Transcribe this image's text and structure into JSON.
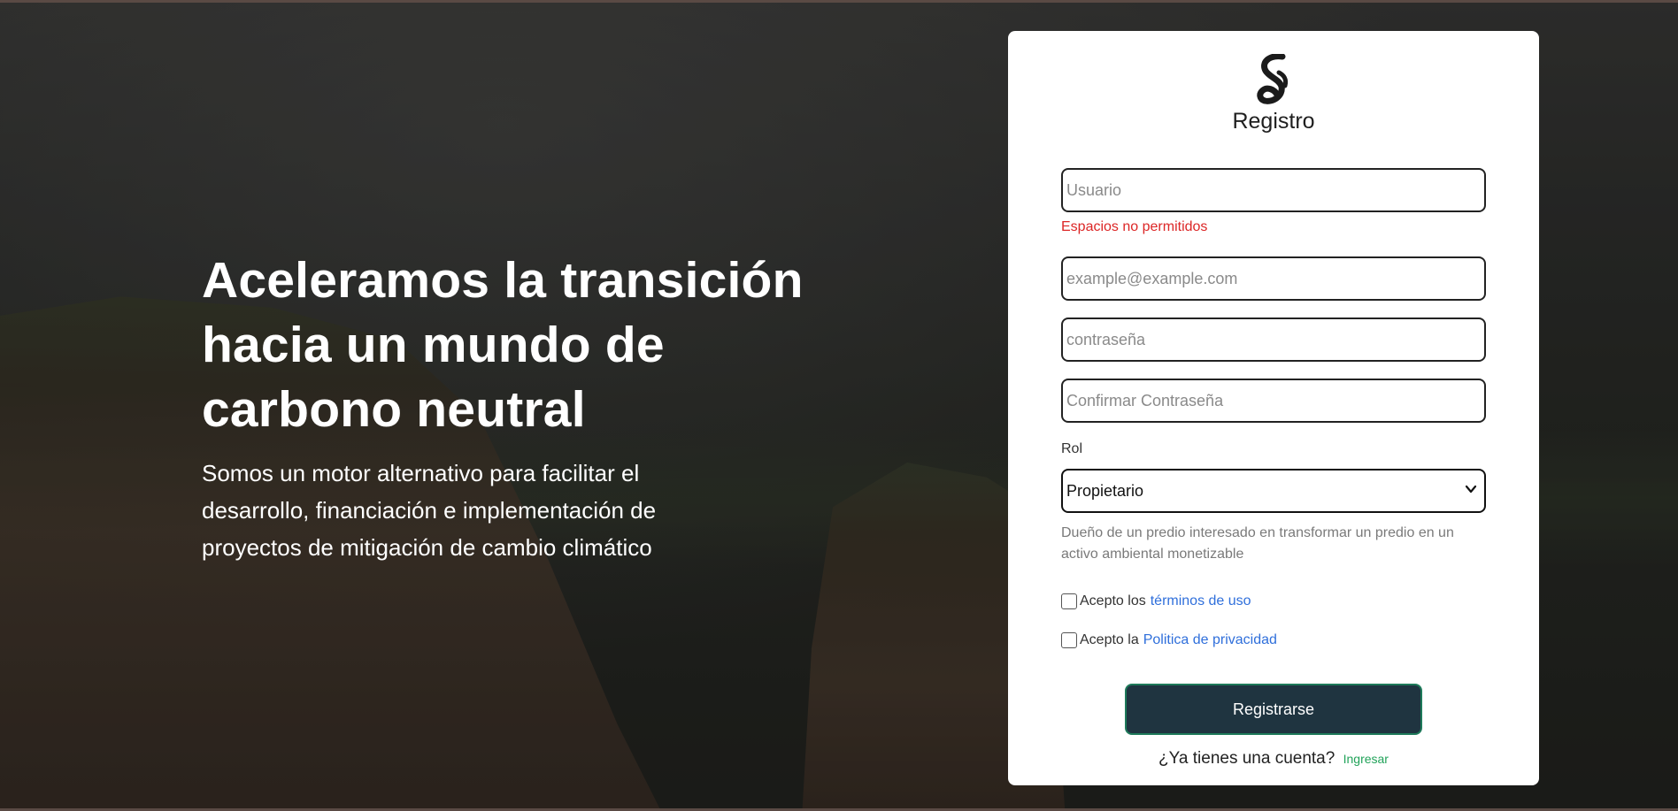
{
  "hero": {
    "title": "Aceleramos la transición hacia un mundo de carbono neutral",
    "subtitle": "Somos un motor alternativo para facilitar el desarrollo, financiación e implementación de proyectos de mitigación de cambio climático"
  },
  "form": {
    "logo_icon": "brand-logo-icon",
    "title": "Registro",
    "username": {
      "placeholder": "Usuario",
      "value": ""
    },
    "username_error": "Espacios no permitidos",
    "email": {
      "placeholder": "example@example.com",
      "value": ""
    },
    "password": {
      "placeholder": "contraseña",
      "value": ""
    },
    "confirm_password": {
      "placeholder": "Confirmar Contraseña",
      "value": ""
    },
    "role_label": "Rol",
    "role_selected": "Propietario",
    "role_description": "Dueño de un predio interesado en transformar un predio en un activo ambiental monetizable",
    "terms": {
      "prefix": "Acepto los",
      "link": "términos de uso",
      "checked": false
    },
    "privacy": {
      "prefix": "Acepto la",
      "link": "Politica de privacidad",
      "checked": false
    },
    "submit_label": "Registrarse",
    "have_account": "¿Ya tienes una cuenta?",
    "login_link": "Ingresar"
  },
  "colors": {
    "error": "#dc2626",
    "link": "#2f6fdb",
    "login_link": "#22a35a",
    "button_bg": "#1f3440",
    "button_border": "#1e7a5a"
  }
}
